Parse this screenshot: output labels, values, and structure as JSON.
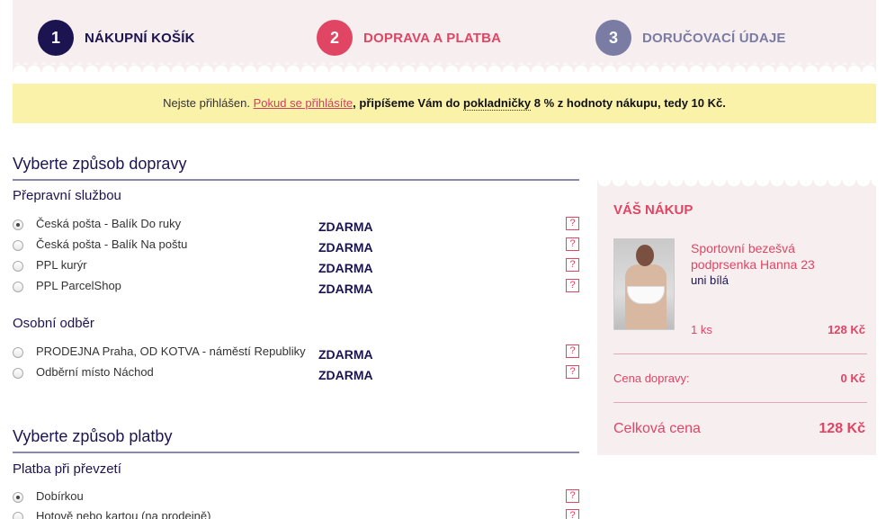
{
  "steps": [
    {
      "number": "1",
      "label": "NÁKUPNÍ KOŠÍK"
    },
    {
      "number": "2",
      "label": "DOPRAVA A PLATBA"
    },
    {
      "number": "3",
      "label": "DORUČOVACÍ ÚDAJE"
    }
  ],
  "notice": {
    "prefix": "Nejste přihlášen. ",
    "link": "Pokud se přihlásíte",
    "bold_start": ", připíšeme Vám do ",
    "bold_underlined": "pokladničky",
    "bold_end": " 8 % z hodnoty nákupu, tedy 10 Kč."
  },
  "shipping": {
    "title": "Vyberte způsob dopravy",
    "carrier_heading": "Přepravní službou",
    "carrier_options": [
      {
        "name": "Česká pošta - Balík Do ruky",
        "price": "ZDARMA",
        "checked": true
      },
      {
        "name": "Česká pošta - Balík Na poštu",
        "price": "ZDARMA",
        "checked": false
      },
      {
        "name": "PPL kurýr",
        "price": "ZDARMA",
        "checked": false
      },
      {
        "name": "PPL ParcelShop",
        "price": "ZDARMA",
        "checked": false
      }
    ],
    "pickup_heading": "Osobní odběr",
    "pickup_options": [
      {
        "name": "PRODEJNA Praha, OD KOTVA - náměstí Republiky",
        "price": "ZDARMA",
        "checked": false
      },
      {
        "name": "Odběrní místo Náchod",
        "price": "ZDARMA",
        "checked": false
      }
    ],
    "help_label": "?"
  },
  "payment": {
    "title": "Vyberte způsob platby",
    "heading": "Platba při převzetí",
    "options": [
      {
        "name": "Dobírkou",
        "checked": true
      },
      {
        "name": "Hotově nebo kartou (na prodejně)",
        "checked": false
      }
    ]
  },
  "cart": {
    "title": "VÁŠ NÁKUP",
    "product_name": "Sportovní bezešvá podprsenka Hanna 23",
    "product_variant": "uni bílá",
    "quantity": "1 ks",
    "product_price": "128 Kč",
    "shipping_label": "Cena dopravy:",
    "shipping_value": "0 Kč",
    "total_label": "Celková cena",
    "total_value": "128 Kč"
  },
  "colors": {
    "navy": "#1c1450",
    "pink": "#e04563",
    "grey_purple": "#7b7ca3",
    "notice_bg": "#fbf2aa",
    "panel_bg": "#f7eef0"
  }
}
